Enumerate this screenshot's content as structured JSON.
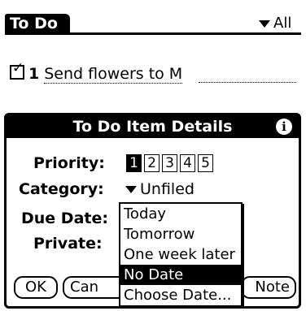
{
  "app": {
    "title": "To Do",
    "category_filter": "All"
  },
  "todo_item": {
    "checked": true,
    "priority": "1",
    "description": "Send flowers to M"
  },
  "dialog": {
    "title": "To Do Item Details",
    "priority_label": "Priority:",
    "priority_options": [
      "1",
      "2",
      "3",
      "4",
      "5"
    ],
    "priority_selected": "1",
    "category_label": "Category:",
    "category_value": "Unfiled",
    "due_date_label": "Due Date:",
    "private_label": "Private:",
    "buttons": {
      "ok": "OK",
      "cancel": "Can",
      "note": "Note"
    }
  },
  "due_date_popup": {
    "items": [
      "Today",
      "Tomorrow",
      "One week later",
      "No Date",
      "Choose Date..."
    ],
    "selected": "No Date"
  },
  "icons": {
    "check": "checkbox-check-icon",
    "dropdown": "triangle-down-icon",
    "info": "info-icon"
  }
}
